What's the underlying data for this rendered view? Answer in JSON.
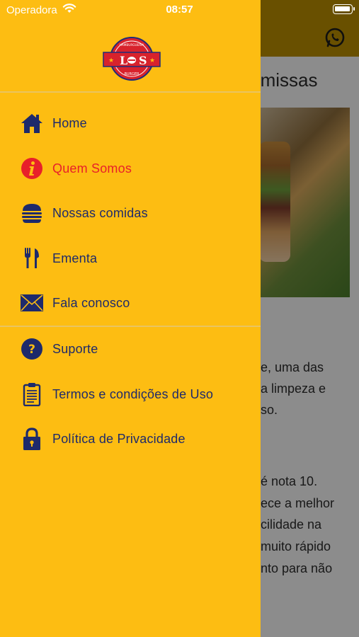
{
  "status_bar": {
    "carrier": "Operadora",
    "time": "08:57"
  },
  "background": {
    "title_fragment": "premissas",
    "text_lines": [
      "e, uma das",
      "a limpeza e",
      "so.",
      "é nota 10.",
      "ece a melhor",
      "cilidade na",
      "muito rápido",
      "nto para não"
    ]
  },
  "drawer": {
    "logo": {
      "text": "LOS",
      "top_text": "HAMBURGUERIA",
      "bottom_text": "BURGER",
      "colors": {
        "red": "#d8222c",
        "navy": "#1f2c7a"
      }
    },
    "primary_items": [
      {
        "label": "Home",
        "icon": "home-icon",
        "active": false
      },
      {
        "label": "Quem Somos",
        "icon": "info-icon",
        "active": true
      },
      {
        "label": "Nossas comidas",
        "icon": "burger-icon",
        "active": false
      },
      {
        "label": "Ementa",
        "icon": "cutlery-icon",
        "active": false
      },
      {
        "label": "Fala conosco",
        "icon": "envelope-icon",
        "active": false
      }
    ],
    "secondary_items": [
      {
        "label": "Suporte",
        "icon": "help-icon",
        "active": false
      },
      {
        "label": "Termos e condições de Uso",
        "icon": "clipboard-icon",
        "active": false
      },
      {
        "label": "Política de Privacidade",
        "icon": "lock-icon",
        "active": false
      }
    ]
  },
  "colors": {
    "drawer_bg": "#fdbd12",
    "icon_navy": "#1e2a6b",
    "active_red": "#e8202a"
  }
}
